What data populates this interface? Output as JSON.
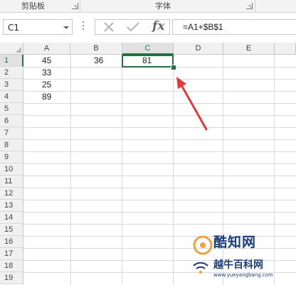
{
  "ribbon": {
    "group_clipboard": "剪贴板",
    "group_font": "字体"
  },
  "formula_bar": {
    "name_box": "C1",
    "fx_label": "fx",
    "formula": "=A1+$B$1"
  },
  "sheet": {
    "columns": [
      "A",
      "B",
      "C",
      "D",
      "E"
    ],
    "active_column": "C",
    "rows": [
      "1",
      "2",
      "3",
      "4",
      "5",
      "6",
      "7",
      "8",
      "9",
      "10",
      "11",
      "12",
      "13",
      "14",
      "15",
      "16",
      "17",
      "18",
      "19"
    ],
    "active_row": "1",
    "cells": {
      "A1": "45",
      "A2": "33",
      "A3": "25",
      "A4": "89",
      "B1": "36",
      "C1": "81"
    }
  },
  "watermark": {
    "title": "酷知网",
    "subtitle": "越牛百科网",
    "url": "www.yueyangbang.com"
  },
  "colors": {
    "accent": "#217346",
    "arrow": "#e03a3a",
    "watermark": "#1a3d7c"
  }
}
